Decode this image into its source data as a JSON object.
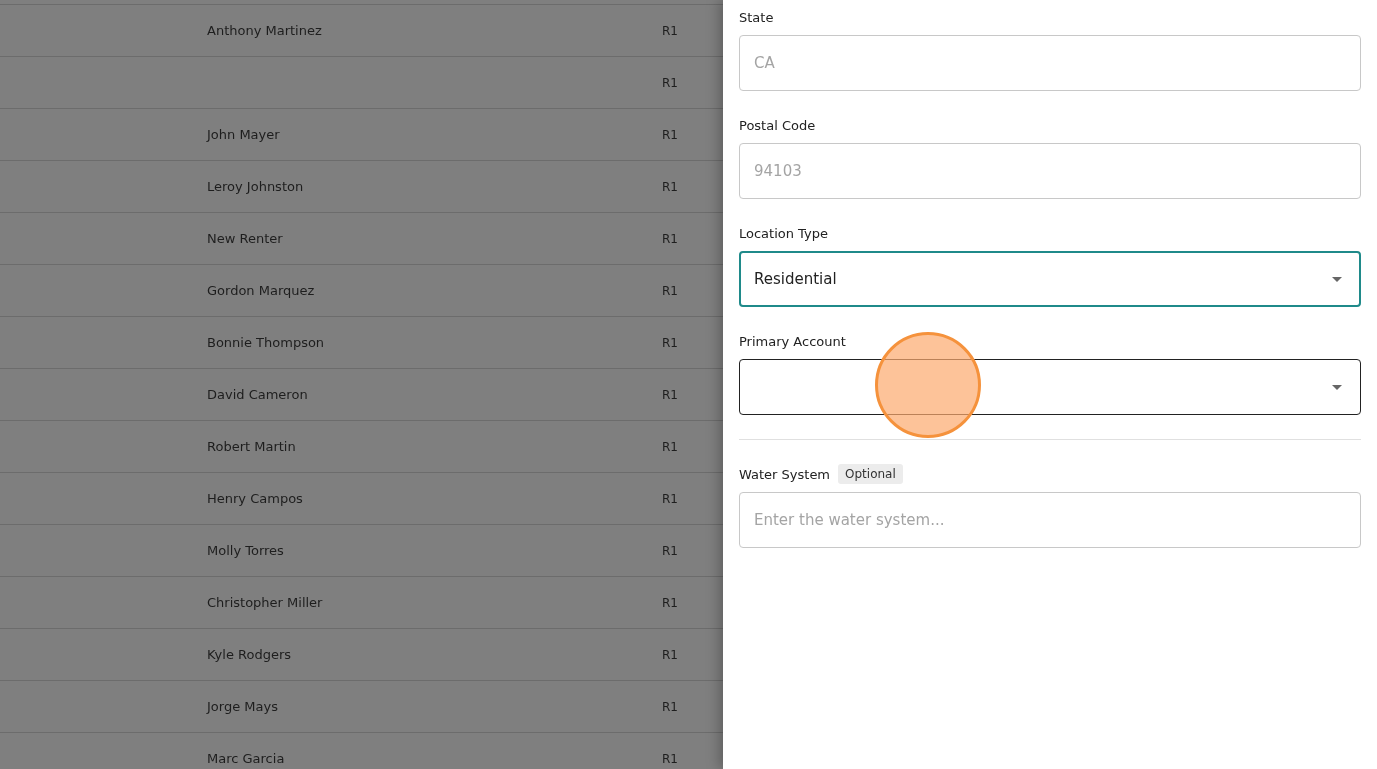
{
  "table": {
    "rows": [
      {
        "name": "Anthony Martinez",
        "code": "R1"
      },
      {
        "name": "",
        "code": "R1"
      },
      {
        "name": "John Mayer",
        "code": "R1"
      },
      {
        "name": "Leroy Johnston",
        "code": "R1"
      },
      {
        "name": "New Renter",
        "code": "R1"
      },
      {
        "name": "Gordon Marquez",
        "code": "R1"
      },
      {
        "name": "Bonnie Thompson",
        "code": "R1"
      },
      {
        "name": "David Cameron",
        "code": "R1"
      },
      {
        "name": "Robert Martin",
        "code": "R1"
      },
      {
        "name": "Henry Campos",
        "code": "R1"
      },
      {
        "name": "Molly Torres",
        "code": "R1"
      },
      {
        "name": "Christopher Miller",
        "code": "R1"
      },
      {
        "name": "Kyle Rodgers",
        "code": "R1"
      },
      {
        "name": "Jorge Mays",
        "code": "R1"
      },
      {
        "name": "Marc Garcia",
        "code": "R1"
      }
    ]
  },
  "form": {
    "fields": [
      {
        "kind": "input",
        "label": "State",
        "placeholder": "CA",
        "focused": false,
        "hovered": false
      },
      {
        "kind": "input",
        "label": "Postal Code",
        "placeholder": "94103",
        "focused": false,
        "hovered": false
      },
      {
        "kind": "select",
        "label": "Location Type",
        "value": "Residential",
        "focused": true,
        "hovered": false
      },
      {
        "kind": "select",
        "label": "Primary Account",
        "focused": false,
        "hovered": true
      },
      {
        "kind": "divider"
      },
      {
        "kind": "input",
        "label": "Water System",
        "badge": "Optional",
        "placeholder": "Enter the water system...",
        "focused": false,
        "hovered": false
      }
    ]
  }
}
